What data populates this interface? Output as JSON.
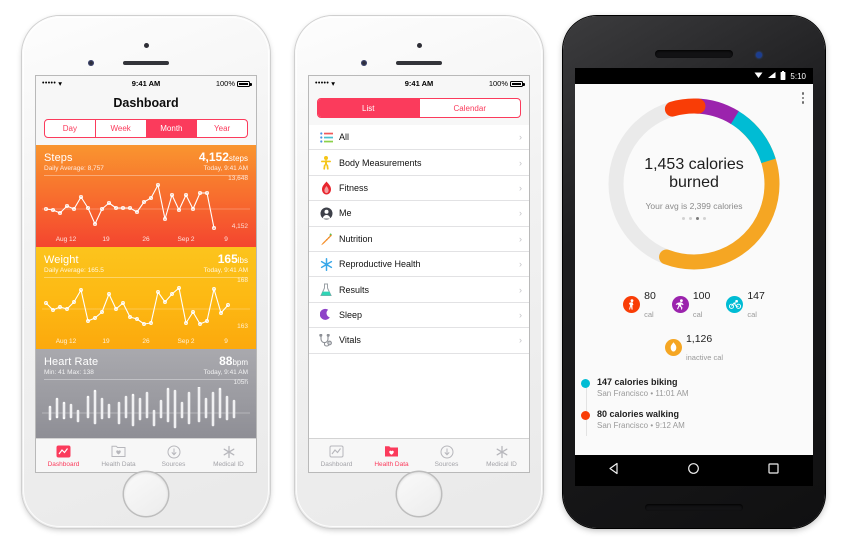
{
  "phone1": {
    "status": {
      "signal": "•••••",
      "wifi": "wifi-icon",
      "time": "9:41 AM",
      "battery": "100%"
    },
    "title": "Dashboard",
    "segments": [
      {
        "label": "Day",
        "active": false
      },
      {
        "label": "Week",
        "active": false
      },
      {
        "label": "Month",
        "active": true
      },
      {
        "label": "Year",
        "active": false
      }
    ],
    "cards": [
      {
        "title": "Steps",
        "subtitle": "Daily Average: 8,757",
        "value": "4,152",
        "unit": "steps",
        "timestamp": "Today, 9:41 AM",
        "max_label": "13,648",
        "min_label": "4,152",
        "axis": [
          "Aug 12",
          "19",
          "26",
          "Sep 2",
          "9"
        ]
      },
      {
        "title": "Weight",
        "subtitle": "Daily Average: 165.5",
        "value": "165",
        "unit": "lbs",
        "timestamp": "Today, 9:41 AM",
        "max_label": "168",
        "min_label": "163",
        "axis": [
          "Aug 12",
          "19",
          "26",
          "Sep 2",
          "9"
        ]
      },
      {
        "title": "Heart Rate",
        "subtitle": "Min: 41 Max: 138",
        "value": "88",
        "unit": "bpm",
        "timestamp": "Today, 9:41 AM",
        "max_label": "105h",
        "min_label": "",
        "axis": []
      }
    ],
    "tabs": [
      {
        "label": "Dashboard",
        "icon": "dashboard-chart-icon",
        "active": true
      },
      {
        "label": "Health Data",
        "icon": "health-data-folder-icon",
        "active": false
      },
      {
        "label": "Sources",
        "icon": "sources-download-icon",
        "active": false
      },
      {
        "label": "Medical ID",
        "icon": "medical-id-asterisk-icon",
        "active": false
      }
    ]
  },
  "phone2": {
    "status": {
      "signal": "•••••",
      "wifi": "wifi-icon",
      "time": "9:41 AM",
      "battery": "100%"
    },
    "segments": [
      {
        "label": "List",
        "active": true
      },
      {
        "label": "Calendar",
        "active": false
      }
    ],
    "list": [
      {
        "label": "All",
        "icon": "list-lines-icon"
      },
      {
        "label": "Body Measurements",
        "icon": "body-person-icon"
      },
      {
        "label": "Fitness",
        "icon": "flame-icon"
      },
      {
        "label": "Me",
        "icon": "person-head-icon"
      },
      {
        "label": "Nutrition",
        "icon": "carrot-icon"
      },
      {
        "label": "Reproductive Health",
        "icon": "snowflake-icon"
      },
      {
        "label": "Results",
        "icon": "flask-icon"
      },
      {
        "label": "Sleep",
        "icon": "moon-icon"
      },
      {
        "label": "Vitals",
        "icon": "stethoscope-icon"
      }
    ],
    "chevron": "›",
    "tabs": [
      {
        "label": "Dashboard",
        "icon": "dashboard-chart-icon",
        "active": false
      },
      {
        "label": "Health Data",
        "icon": "health-data-folder-icon",
        "active": true
      },
      {
        "label": "Sources",
        "icon": "sources-download-icon",
        "active": false
      },
      {
        "label": "Medical ID",
        "icon": "medical-id-asterisk-icon",
        "active": false
      }
    ]
  },
  "phone3": {
    "status": {
      "time": "5:10",
      "icons": [
        "wifi-icon",
        "signal-icon",
        "battery-icon"
      ]
    },
    "overflow_menu": "kebab-menu-icon",
    "summary": {
      "headline": "1,453 calories",
      "headline2": "burned",
      "average": "Your avg is 2,399 calories",
      "page_dots": 4,
      "active_dot": 3
    },
    "stats": [
      {
        "value": "80",
        "unit": "cal",
        "icon": "walking-icon",
        "color": "#f93d06"
      },
      {
        "value": "100",
        "unit": "cal",
        "icon": "running-icon",
        "color": "#9b23ad"
      },
      {
        "value": "147",
        "unit": "cal",
        "icon": "biking-icon",
        "color": "#00bcd4"
      },
      {
        "value": "1,126",
        "unit": "inactive cal",
        "icon": "flame-icon",
        "color": "#f5a623"
      }
    ],
    "activities": [
      {
        "title": "147 calories biking",
        "meta": "San Francisco • 11:01 AM",
        "color": "#00bcd4"
      },
      {
        "title": "80 calories walking",
        "meta": "San Francisco • 9:12 AM",
        "color": "#f93d06"
      }
    ],
    "nav": [
      "back-triangle-icon",
      "home-circle-icon",
      "recents-square-icon"
    ]
  },
  "chart_data": [
    {
      "type": "line",
      "title": "Steps",
      "ylabel": "steps",
      "ylim": [
        4152,
        13648
      ],
      "xlabel": "",
      "categories": [
        "Aug 12",
        "19",
        "26",
        "Sep 2",
        "9"
      ],
      "values": [
        8100,
        7900,
        7200,
        9000,
        8050,
        11200,
        8200,
        5400,
        8100,
        9300,
        8300,
        8350,
        8300,
        7750,
        9400,
        10100,
        13648,
        6500,
        10600,
        7900,
        10600,
        8100,
        10750,
        10700,
        4152
      ],
      "grid": false,
      "daily_average": 8757,
      "current_value": 4152
    },
    {
      "type": "line",
      "title": "Weight",
      "ylabel": "lbs",
      "ylim": [
        163,
        168
      ],
      "categories": [
        "Aug 12",
        "19",
        "26",
        "Sep 2",
        "9"
      ],
      "values": [
        166.2,
        165.4,
        165.9,
        165.5,
        166.3,
        167.3,
        164.2,
        164.4,
        164.9,
        166.6,
        165.4,
        165.9,
        164.6,
        164.4,
        164.0,
        164.1,
        166.8,
        166.2,
        166.6,
        167.2,
        164.3,
        164.9,
        164.2,
        164.4,
        167.3,
        165.1,
        166.0
      ],
      "grid": false,
      "daily_average": 165.5,
      "current_value": 165
    },
    {
      "type": "bar",
      "title": "Heart Rate",
      "ylabel": "bpm",
      "ylim": [
        41,
        138
      ],
      "categories": [],
      "series": [
        {
          "name": "min",
          "values": [
            70,
            62,
            68,
            64,
            72,
            70,
            55,
            60,
            66,
            64,
            72,
            86,
            78,
            72,
            76,
            70,
            64,
            62,
            70,
            74,
            54,
            64,
            70,
            62,
            68,
            72,
            58,
            66,
            70,
            64
          ]
        },
        {
          "name": "max",
          "values": [
            92,
            104,
            98,
            96,
            88,
            108,
            118,
            104,
            96,
            98,
            104,
            108,
            102,
            110,
            112,
            96,
            114,
            118,
            100,
            116,
            108,
            100,
            126,
            108,
            112,
            104,
            102,
            116,
            108,
            98
          ]
        }
      ],
      "current_value": 88,
      "min": 41,
      "max": 138
    },
    {
      "type": "pie",
      "title": "1,453 calories burned",
      "labels": [
        "walking",
        "running",
        "biking",
        "inactive",
        "remaining"
      ],
      "values": [
        80,
        100,
        147,
        1126,
        946
      ],
      "colors": [
        "#f93d06",
        "#9b23ad",
        "#00bcd4",
        "#f5a623",
        "#eaeaea"
      ],
      "legend": "below",
      "annotation": "Your avg is 2,399 calories"
    }
  ]
}
